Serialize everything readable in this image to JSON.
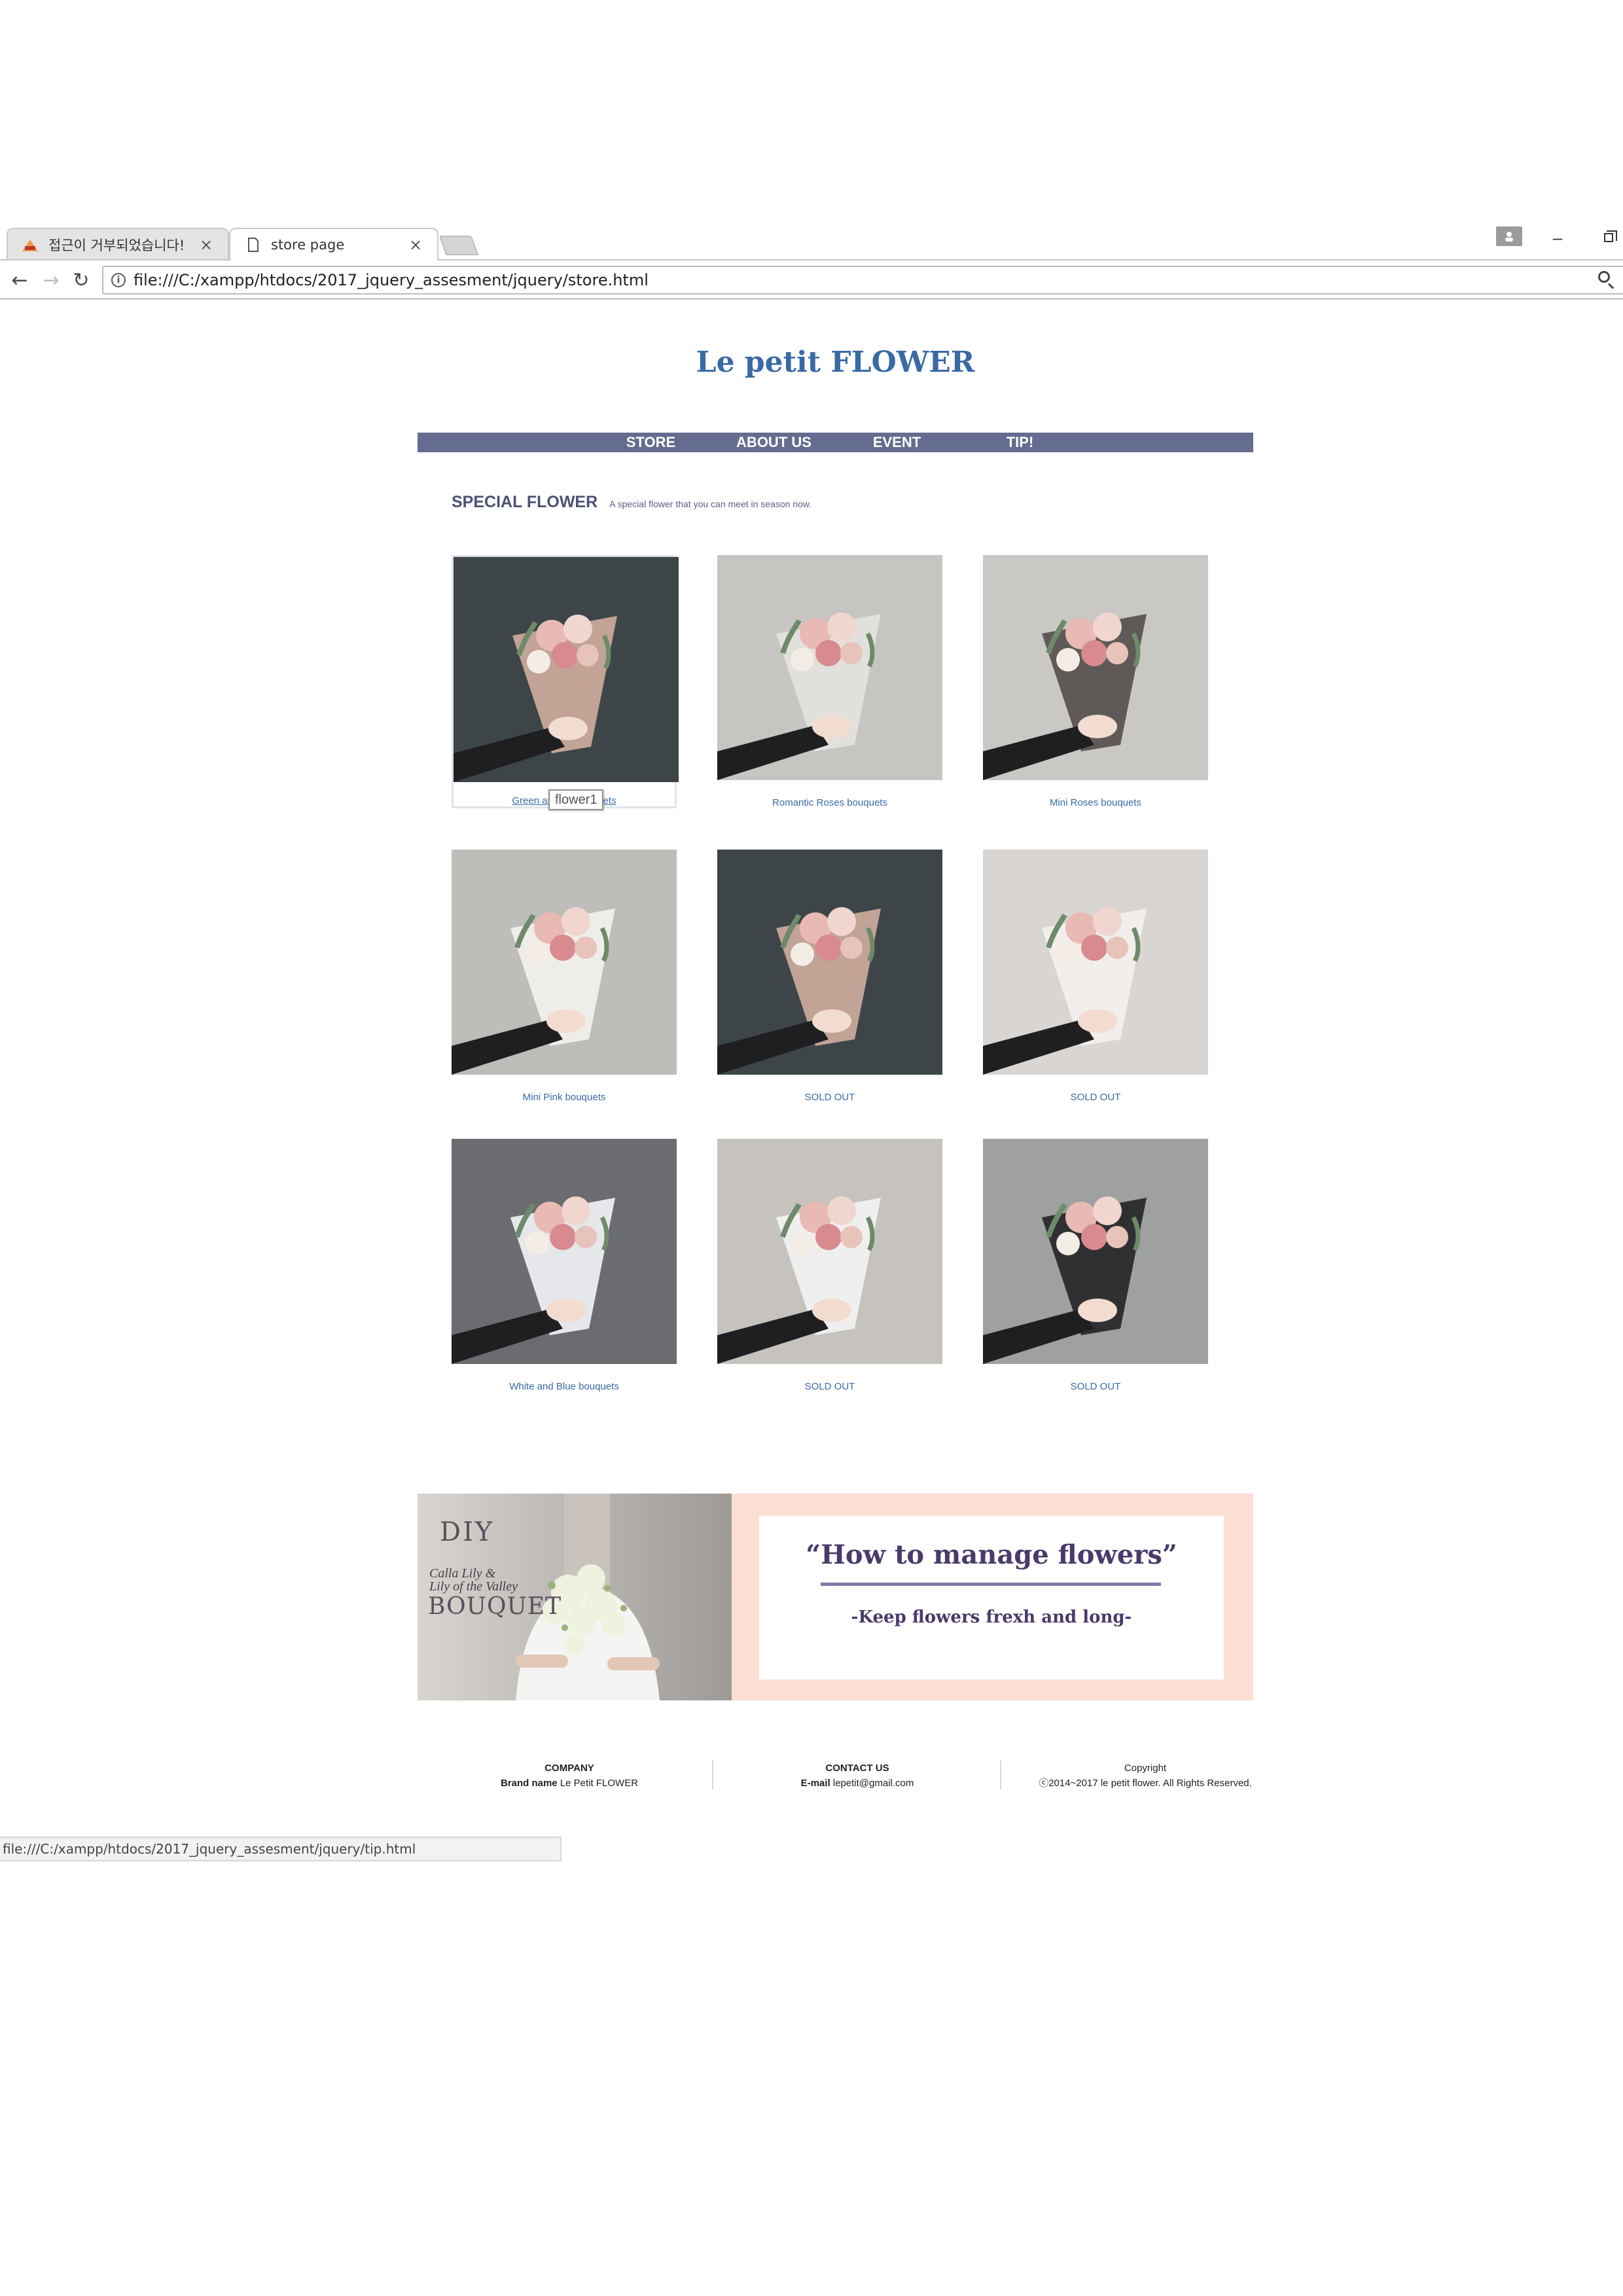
{
  "browser": {
    "tabs": [
      {
        "title": "접근이 거부되었습니다!",
        "close": "×"
      },
      {
        "title": "store page",
        "close": "×"
      }
    ],
    "url": "file:///C:/xampp/htdocs/2017_jquery_assesment/jquery/store.html",
    "nav": {
      "back": "←",
      "forward": "→",
      "reload": "↻"
    },
    "window": {
      "minimize": "–"
    },
    "status_url": "file:///C:/xampp/htdocs/2017_jquery_assesment/jquery/tip.html"
  },
  "brand": "Le petit FLOWER",
  "nav": [
    "STORE",
    "ABOUT US",
    "EVENT",
    "TIP!"
  ],
  "special": {
    "heading": "SPECIAL FLOWER",
    "subtitle": "A special flower that you can meet in season now."
  },
  "products": [
    {
      "caption": "Green and ... bouquets",
      "caption_left": "Green ar",
      "caption_right": "ets",
      "bg": "#3d4548",
      "paper": "#c9a99a"
    },
    {
      "caption": "Romantic Roses bouquets",
      "bg": "#c7c5c2",
      "paper": "#e4e2de"
    },
    {
      "caption": "Mini Roses bouquets",
      "bg": "#c9c8c5",
      "paper": "#5a5452"
    },
    {
      "caption": "Mini Pink bouquets",
      "bg": "#bfbdba",
      "paper": "#f0efec"
    },
    {
      "caption": "SOLD OUT",
      "bg": "#3d4548",
      "paper": "#c9a99a"
    },
    {
      "caption": "SOLD OUT",
      "bg": "#d8d5d2",
      "paper": "#f2efec"
    },
    {
      "caption": "White and Blue bouquets",
      "bg": "#6a6c70",
      "paper": "#eceef0"
    },
    {
      "caption": "SOLD OUT",
      "bg": "#c6c3bf",
      "paper": "#f1f1f1"
    },
    {
      "caption": "SOLD OUT",
      "bg": "#9ea0a2",
      "paper": "#2a2a2c"
    }
  ],
  "tooltip": "flower1",
  "banner": {
    "photo_text": {
      "diy": "DIY",
      "calla_1": "Calla Lily &",
      "calla_2": "Lily of the Valley",
      "bouquet": "BOUQUET"
    },
    "title": "“How to manage flowers”",
    "subtitle": "-Keep flowers frexh and long-"
  },
  "footer": [
    {
      "heading": "COMPANY",
      "label": "Brand name",
      "value": "Le Petit FLOWER"
    },
    {
      "heading": "CONTACT US",
      "label": "E-mail",
      "value": "lepetit@gmail.com"
    },
    {
      "heading": "Copyright",
      "label": "",
      "value": "ⓒ2014~2017 le petit flower. All Rights Reserved."
    }
  ],
  "colors": {
    "brand": "#3a6aa6",
    "nav_bg": "#646c8f",
    "banner_bg": "#fbdfd2",
    "banner_text": "#4a3a6a"
  }
}
